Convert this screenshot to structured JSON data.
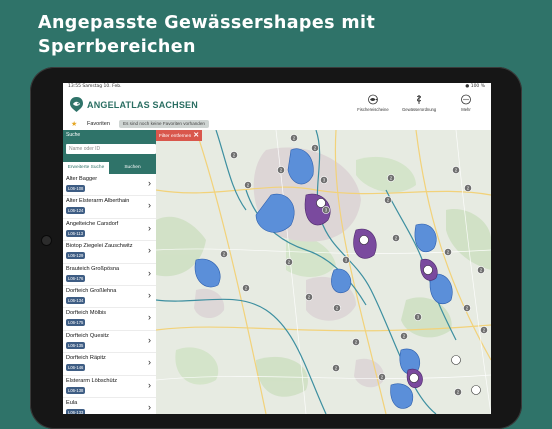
{
  "headline": {
    "line1": "Angepasste Gewässershapes mit",
    "line2": "Sperrbereichen"
  },
  "status_bar": {
    "time": "13:55  Samstag 10. Feb.",
    "battery": "● 100 %"
  },
  "app": {
    "name": "ANGELATLAS SACHSEN",
    "nav": [
      {
        "label": "Fischereischeine",
        "icon": "fishing-license-icon"
      },
      {
        "label": "Gewässerordnung",
        "icon": "regulations-icon"
      },
      {
        "label": "Mehr",
        "icon": "more-icon"
      }
    ]
  },
  "favorites": {
    "star": "★",
    "label": "Favoriten",
    "note": "Es sind noch keine Favoriten vorhanden"
  },
  "search": {
    "title": "Suche",
    "placeholder": "Name oder ID",
    "tab_advanced": "Erweiterte Suche",
    "tab_search": "Suchen"
  },
  "results": [
    {
      "name": "Alter Bagger",
      "code": "L06-108"
    },
    {
      "name": "Alter Elsterarm Alberthain",
      "code": "L06-124"
    },
    {
      "name": "Angelteiche Carsdorf",
      "code": "L06-113"
    },
    {
      "name": "Biotop Ziegelei Zauschwitz",
      "code": "L06-129"
    },
    {
      "name": "Brauteich Großpösna",
      "code": "L06-176"
    },
    {
      "name": "Dorfteich Großlehna",
      "code": "L06-134"
    },
    {
      "name": "Dorfteich Mölbis",
      "code": "L06-175"
    },
    {
      "name": "Dorfteich Quesitz",
      "code": "L06-135"
    },
    {
      "name": "Dorfteich Räpitz",
      "code": "L06-146"
    },
    {
      "name": "Elsterarm Löbschütz",
      "code": "L06-138"
    },
    {
      "name": "Eula",
      "code": "L06-133"
    }
  ],
  "map": {
    "filter_button": "Filter entfernen",
    "filter_close": "✕",
    "cluster_counts": [
      "2",
      "2",
      "2",
      "2",
      "3",
      "2",
      "2",
      "2",
      "2",
      "3",
      "2",
      "2",
      "3",
      "2",
      "2",
      "2",
      "2",
      "2",
      "2",
      "2",
      "2",
      "2",
      "2",
      "2",
      "2",
      "2",
      "3",
      "2"
    ]
  },
  "colors": {
    "brand": "#2f7369",
    "water": "#5b8fd9",
    "restricted": "#7a4a9e",
    "code_badge": "#3e5d84",
    "filter": "#d9574c"
  }
}
